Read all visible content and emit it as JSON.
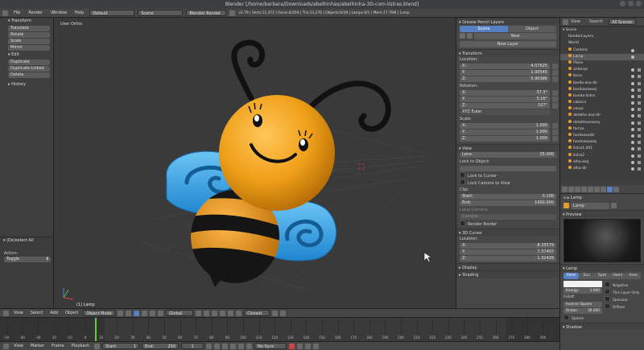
{
  "window": {
    "title": "Blender [/home/barbara/Downloads/abelhinhas/abelhinha-3D-com-listras.blend]"
  },
  "info_header": {
    "menus": [
      "File",
      "Render",
      "Window",
      "Help"
    ],
    "layout": "Default",
    "scene": "Scene",
    "engine": "Blender Render",
    "stats": "v2.79 | Verts:11,472 | Faces:8,659 | Tris:13,276 | Objects:0/19 | Lamps:0/1 | Mem:17.76M | Lamp"
  },
  "toolshelf": {
    "tabs": [
      "Tools",
      "Create",
      "Relations",
      "Animation",
      "Physics",
      "Grease Pencil"
    ],
    "transform_title": "Transform",
    "transform_buttons": [
      "Translate",
      "Rotate",
      "Scale",
      "Mirror"
    ],
    "edit_title": "Edit",
    "edit_buttons": [
      "Duplicate",
      "Duplicate Linked",
      "Delete"
    ],
    "history_title": "History",
    "operator_title": "(De)select All",
    "action_label": "Action:",
    "action_value": "Toggle"
  },
  "viewport": {
    "view_label": "User Ortho",
    "object_label": "(1) Lamp"
  },
  "npanel": {
    "grease_pencil_title": "Grease Pencil Layers",
    "scene_tab": "Scene",
    "object_tab": "Object",
    "new_label": "New",
    "new_layer_label": "New Layer",
    "transform_title": "Transform",
    "location_label": "Location:",
    "location": [
      {
        "axis": "X:",
        "value": "4.07625"
      },
      {
        "axis": "Y:",
        "value": "1.00545"
      },
      {
        "axis": "Z:",
        "value": "5.90386"
      }
    ],
    "rotation_label": "Rotation:",
    "rotation": [
      {
        "axis": "X:",
        "value": "37.3°"
      },
      {
        "axis": "Y:",
        "value": "3.16°"
      },
      {
        "axis": "Z:",
        "value": "107°"
      }
    ],
    "rotation_mode": "XYZ Euler",
    "scale_label": "Scale:",
    "scale": [
      {
        "axis": "X:",
        "value": "1.000"
      },
      {
        "axis": "Y:",
        "value": "1.000"
      },
      {
        "axis": "Z:",
        "value": "1.000"
      }
    ],
    "view_title": "View",
    "lens_label": "Lens:",
    "lens_value": "35.000",
    "lock_to_object": "Lock to Object:",
    "lock_to_cursor": "Lock to Cursor",
    "lock_camera": "Lock Camera to View",
    "clip_label": "Clip:",
    "clip_start_label": "Start:",
    "clip_start": "0.100",
    "clip_end_label": "End:",
    "clip_end": "1000.000",
    "local_camera_label": "Local Camera:",
    "camera_value": "Camera",
    "render_border": "Render Border",
    "cursor_title": "3D Cursor",
    "cursor_location_label": "Location:",
    "cursor": [
      {
        "axis": "X:",
        "value": "8.33579"
      },
      {
        "axis": "Y:",
        "value": "7.37407"
      },
      {
        "axis": "Z:",
        "value": "1.32439"
      }
    ],
    "display_title": "Display",
    "shading_title": "Shading"
  },
  "outliner": {
    "tabs": [
      "View",
      "Search",
      "All Scenes"
    ],
    "items": [
      "Scene",
      "RenderLayers",
      "World",
      "Camera",
      "Lamp",
      "Plane",
      "antenas",
      "boca",
      "borda-asa-dir",
      "bordaasaesq",
      "bunda-listra",
      "cabeca",
      "corpo",
      "detalhe-asa-dir",
      "detalheasaesq",
      "ferrao",
      "fundoasadir",
      "fundoasaesq",
      "listra1.001",
      "listra2",
      "olho-esq",
      "olho-dir"
    ]
  },
  "properties": {
    "breadcrumb": "Lamp",
    "lamp_name": "Lamp",
    "preview_title": "Preview",
    "lamp_title": "Lamp",
    "lamp_types": [
      "Point",
      "Sun",
      "Spot",
      "Hemi",
      "Area"
    ],
    "negative": "Negative",
    "this_layer_only": "This Layer Only",
    "specular": "Specular",
    "diffuse": "Diffuse",
    "energy_label": "Energy:",
    "energy_value": "1.000",
    "falloff_label": "Falloff:",
    "falloff_value": "Inverse Square",
    "distance_label": "Distan:",
    "distance_value": "30.000",
    "sphere": "Sphere",
    "shadow_title": "Shadow"
  },
  "view3d_header": {
    "menus": [
      "View",
      "Select",
      "Add",
      "Object"
    ],
    "mode": "Object Mode",
    "pivot": "Global",
    "snap": "Closest"
  },
  "timeline": {
    "ticks": [
      "-50",
      "-40",
      "-30",
      "-20",
      "-10",
      "0",
      "10",
      "20",
      "30",
      "40",
      "50",
      "60",
      "70",
      "80",
      "90",
      "100",
      "110",
      "120",
      "130",
      "140",
      "150",
      "160",
      "170",
      "180",
      "190",
      "200",
      "210",
      "220",
      "230",
      "240",
      "250",
      "260",
      "270",
      "280",
      "290"
    ],
    "menus": [
      "View",
      "Marker",
      "Frame",
      "Playback"
    ],
    "start_label": "Start:",
    "start_value": "1",
    "end_label": "End:",
    "end_value": "250",
    "current_frame": "1",
    "sync": "No Sync"
  },
  "colors": {
    "bee_yellow": "#f0a019",
    "bee_black": "#161616",
    "wing_blue": "#3aa3e6",
    "accent_blue": "#5680c2",
    "current_frame_green": "#5ecf3b"
  }
}
